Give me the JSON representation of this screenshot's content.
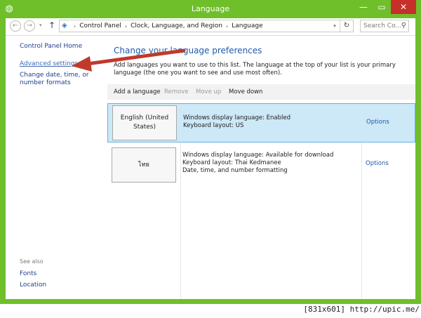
{
  "window": {
    "title": "Language",
    "min_glyph": "—",
    "max_glyph": "▭",
    "close_glyph": "✕",
    "icon": "globe-icon"
  },
  "address": {
    "back_glyph": "←",
    "forward_glyph": "→",
    "dropdown_glyph": "▾",
    "up_glyph": "↑",
    "crumbs": [
      "Control Panel",
      "Clock, Language, and Region",
      "Language"
    ],
    "crumb_sep": "›",
    "refresh_glyph": "↻",
    "search_placeholder": "Search Co...",
    "search_glyph": "⚲"
  },
  "sidebar": {
    "home": "Control Panel Home",
    "advanced": "Advanced settings",
    "change_formats": "Change date, time, or number formats",
    "see_also": "See also",
    "fonts": "Fonts",
    "location": "Location"
  },
  "main": {
    "title": "Change your language preferences",
    "description": "Add languages you want to use to this list. The language at the top of your list is your primary language (the one you want to see and use most often).",
    "toolbar": {
      "add": "Add a language",
      "remove": "Remove",
      "move_up": "Move up",
      "move_down": "Move down"
    },
    "languages": [
      {
        "name": "English (United States)",
        "line1": "Windows display language: Enabled",
        "line2": "Keyboard layout: US",
        "line3": "",
        "options": "Options"
      },
      {
        "name": "ไทย",
        "line1": "Windows display language: Available for download",
        "line2": "Keyboard layout: Thai Kedmanee",
        "line3": "Date, time, and number formatting",
        "options": "Options"
      }
    ]
  },
  "watermark": "[831x601] http://upic.me/",
  "colors": {
    "title_bar": "#6fbf2a",
    "close_button": "#c7302a",
    "selected_row": "#cde8f6",
    "link": "#1e5aa8",
    "annotation_arrow": "#c0392b"
  }
}
